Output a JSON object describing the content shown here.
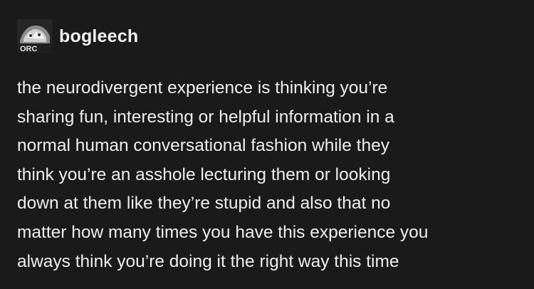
{
  "post": {
    "author": {
      "username": "bogleech",
      "avatar_icon": "avatar-icon",
      "avatar_text": "ORC"
    },
    "body_lines": [
      "the neurodivergent experience is thinking you’re",
      "sharing fun, interesting or helpful information in a",
      "normal human conversational fashion while they",
      "think you’re an asshole lecturing them or looking",
      "down at them like they’re stupid and also that no",
      "matter how many times you have this experience you",
      "always think you’re doing it the right way this time"
    ]
  },
  "colors": {
    "background": "#1a1a1a",
    "text": "#efefef"
  }
}
